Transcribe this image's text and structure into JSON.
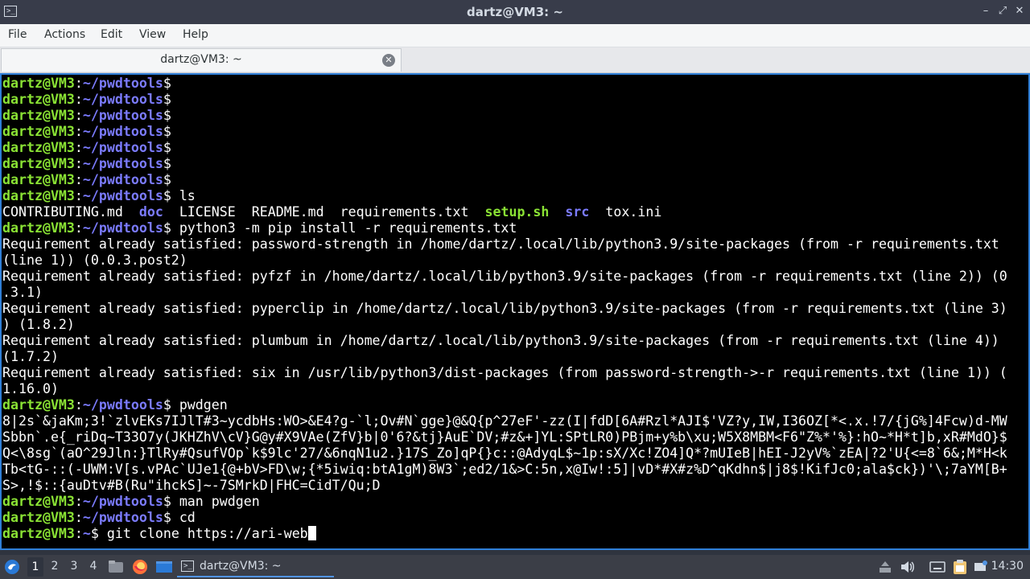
{
  "window": {
    "title": "dartz@VM3: ~",
    "minimize": "–",
    "maximize": "⤢",
    "close": "✕"
  },
  "menu": [
    "File",
    "Actions",
    "Edit",
    "View",
    "Help"
  ],
  "tab": {
    "label": "dartz@VM3: ~",
    "close": "✕"
  },
  "terminal": {
    "user": "dartz@VM3",
    "lines": [
      {
        "t": "prompt",
        "dir": "~/pwdtools",
        "cmd": ""
      },
      {
        "t": "prompt",
        "dir": "~/pwdtools",
        "cmd": ""
      },
      {
        "t": "prompt",
        "dir": "~/pwdtools",
        "cmd": ""
      },
      {
        "t": "prompt",
        "dir": "~/pwdtools",
        "cmd": ""
      },
      {
        "t": "prompt",
        "dir": "~/pwdtools",
        "cmd": ""
      },
      {
        "t": "prompt",
        "dir": "~/pwdtools",
        "cmd": ""
      },
      {
        "t": "prompt",
        "dir": "~/pwdtools",
        "cmd": ""
      },
      {
        "t": "prompt",
        "dir": "~/pwdtools",
        "cmd": " ls"
      },
      {
        "t": "ls",
        "items": [
          {
            "text": "CONTRIBUTING.md",
            "kind": "file"
          },
          {
            "text": "doc",
            "kind": "dir"
          },
          {
            "text": "LICENSE",
            "kind": "file"
          },
          {
            "text": "README.md",
            "kind": "file"
          },
          {
            "text": "requirements.txt",
            "kind": "file"
          },
          {
            "text": "setup.sh",
            "kind": "exe"
          },
          {
            "text": "src",
            "kind": "dir"
          },
          {
            "text": "tox.ini",
            "kind": "file"
          }
        ]
      },
      {
        "t": "prompt",
        "dir": "~/pwdtools",
        "cmd": " python3 -m pip install -r requirements.txt"
      },
      {
        "t": "out",
        "text": "Requirement already satisfied: password-strength in /home/dartz/.local/lib/python3.9/site-packages (from -r requirements.txt"
      },
      {
        "t": "out",
        "text": "(line 1)) (0.0.3.post2)"
      },
      {
        "t": "out",
        "text": "Requirement already satisfied: pyfzf in /home/dartz/.local/lib/python3.9/site-packages (from -r requirements.txt (line 2)) (0"
      },
      {
        "t": "out",
        "text": ".3.1)"
      },
      {
        "t": "out",
        "text": "Requirement already satisfied: pyperclip in /home/dartz/.local/lib/python3.9/site-packages (from -r requirements.txt (line 3)"
      },
      {
        "t": "out",
        "text": ") (1.8.2)"
      },
      {
        "t": "out",
        "text": "Requirement already satisfied: plumbum in /home/dartz/.local/lib/python3.9/site-packages (from -r requirements.txt (line 4))"
      },
      {
        "t": "out",
        "text": "(1.7.2)"
      },
      {
        "t": "out",
        "text": "Requirement already satisfied: six in /usr/lib/python3/dist-packages (from password-strength->-r requirements.txt (line 1)) ("
      },
      {
        "t": "out",
        "text": "1.16.0)"
      },
      {
        "t": "prompt",
        "dir": "~/pwdtools",
        "cmd": " pwdgen"
      },
      {
        "t": "out",
        "text": "8|2s`&jaKm;3!`zlvEKs7IJlT#3~ycdbHs:WO>&E4?g-`l;Ov#N`gge}@&Q{p^27eF'-zz(I|fdD[6A#Rzl*AJI$'VZ?y,IW,I36OZ[*<.x.!7/{jG%]4Fcw)d-MW"
      },
      {
        "t": "out",
        "text": "Sbbn`.e{_riDq~T33O7y(JKHZhV\\cV}G@y#X9VAe(ZfV}b|0'6?&tj}AuE`DV;#z&+]YL:SPtLR0)PBjm+y%b\\xu;W5X8MBM<F6\"Z%*'%}:hO~*H*t]b,xR#MdO}$"
      },
      {
        "t": "out",
        "text": "Q<\\8sg`(aO^29Jln:}TlRy#QsufVOp`k$9lc'27/&6nqN1u2.}17S_Zo]qP{}c::@AdyqL$~1p:sX/Xc!ZO4]Q*?mUIeB|hEI-J2yV%`zEA|?2'U{<=8`6&;M*H<k"
      },
      {
        "t": "out",
        "text": "Tb<tG-::(-UWM:V[s.vPAc`UJe1{@+bV>FD\\w;{*5iwiq:btA1gM)8W3`;ed2/1&>C:5n,x@Iw!:5]|vD*#X#z%D^qKdhn$|j8$!KifJc0;ala$ck})'\\;7aYM[B+"
      },
      {
        "t": "out",
        "text": "S>,!$::{auDtv#B(Ru\"ihckS]~-7SMrkD|FHC=CidT/Qu;D"
      },
      {
        "t": "prompt",
        "dir": "~/pwdtools",
        "cmd": " man pwdgen"
      },
      {
        "t": "prompt",
        "dir": "~/pwdtools",
        "cmd": " cd"
      },
      {
        "t": "prompt",
        "dir": "~",
        "cmd": " git clone https://ari-web",
        "cursor": true
      }
    ]
  },
  "taskbar": {
    "workspaces": [
      "1",
      "2",
      "3",
      "4"
    ],
    "active_workspace": "1",
    "task_label": "dartz@VM3: ~",
    "clock": "14:30"
  }
}
